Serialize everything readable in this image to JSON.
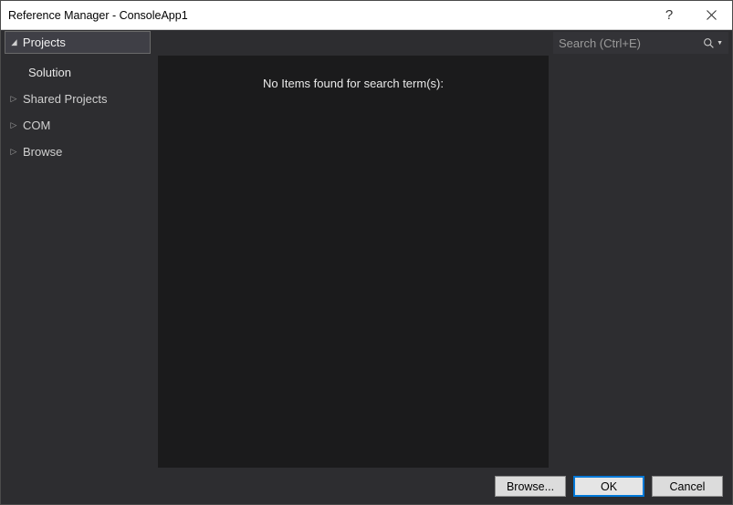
{
  "window": {
    "title": "Reference Manager - ConsoleApp1"
  },
  "tabs": {
    "current_label": "Projects"
  },
  "search": {
    "placeholder": "Search (Ctrl+E)"
  },
  "sidebar": {
    "items": [
      {
        "label": "Solution",
        "sub": true,
        "expandable": false
      },
      {
        "label": "Shared Projects",
        "sub": false,
        "expandable": true
      },
      {
        "label": "COM",
        "sub": false,
        "expandable": true
      },
      {
        "label": "Browse",
        "sub": false,
        "expandable": true
      }
    ]
  },
  "results": {
    "empty_message": "No Items found for search term(s):"
  },
  "footer": {
    "browse_label": "Browse...",
    "ok_label": "OK",
    "cancel_label": "Cancel"
  }
}
